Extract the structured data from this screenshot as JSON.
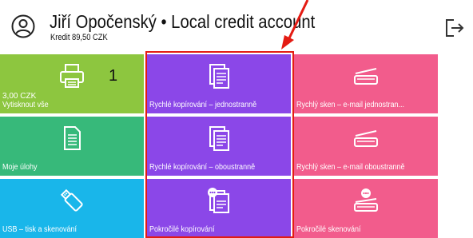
{
  "header": {
    "user_name": "Jiří Opočenský • Local credit account",
    "credit": "Kredit 89,50 CZK"
  },
  "colors": {
    "green": "#8dc63f",
    "purple": "#8b47e8",
    "pink": "#f25c8c",
    "teal": "#37b97a",
    "cyan": "#19b6ea",
    "highlight": "#e41b13"
  },
  "tiles": [
    {
      "label": "Vytisknout vše",
      "sublabel": "3,00 CZK",
      "count": "1",
      "icon": "printer-icon"
    },
    {
      "label": "Rychlé kopírování – jednostranně",
      "icon": "copy-document-icon"
    },
    {
      "label": "Rychlý sken – e-mail jednostran...",
      "icon": "scanner-icon"
    },
    {
      "label": "Moje úlohy",
      "icon": "document-icon"
    },
    {
      "label": "Rychlé kopírování – oboustranně",
      "icon": "copy-document-icon"
    },
    {
      "label": "Rychlý sken – e-mail oboustranně",
      "icon": "scanner-icon"
    },
    {
      "label": "USB – tisk a skenování",
      "icon": "usb-icon"
    },
    {
      "label": "Pokročilé kopírování",
      "icon": "advanced-copy-icon"
    },
    {
      "label": "Pokročilé skenování",
      "icon": "advanced-scan-icon"
    }
  ]
}
